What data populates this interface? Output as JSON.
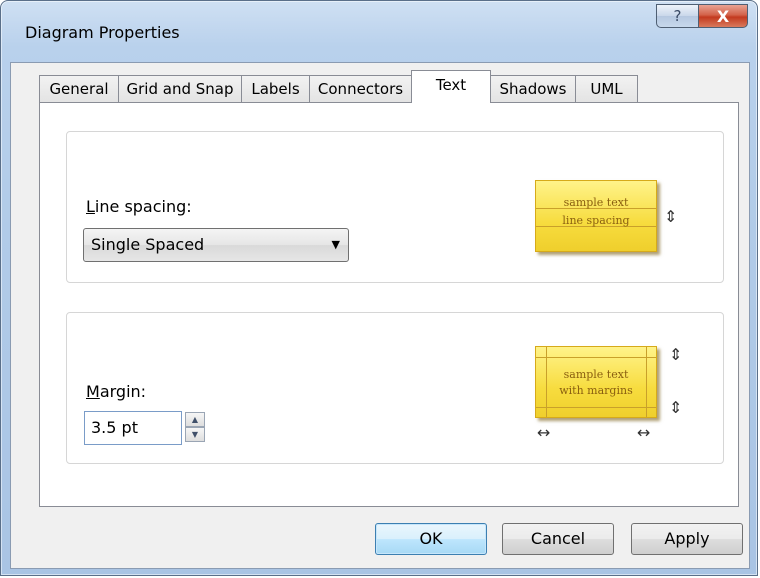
{
  "window": {
    "title": "Diagram Properties",
    "help_label": "?",
    "close_label": "X"
  },
  "tabs": [
    {
      "label": "General",
      "active": false
    },
    {
      "label": "Grid and Snap",
      "active": false
    },
    {
      "label": "Labels",
      "active": false
    },
    {
      "label": "Connectors",
      "active": false
    },
    {
      "label": "Text",
      "active": true
    },
    {
      "label": "Shadows",
      "active": false
    },
    {
      "label": "UML",
      "active": false
    }
  ],
  "line_spacing": {
    "label_mnemonic": "L",
    "label_rest": "ine spacing:",
    "selected": "Single Spaced",
    "dropdown_icon": "triangle-down",
    "preview_line1": "sample text",
    "preview_line2": "line spacing",
    "preview_color": "#f7dc3e",
    "arrow_glyph": "⇕"
  },
  "margin": {
    "label_mnemonic": "M",
    "label_rest": "argin:",
    "value": "3.5 pt",
    "spin_up": "▲",
    "spin_down": "▼",
    "preview_line1": "sample text",
    "preview_line2": "with margins",
    "vertical_arrow_glyph": "⇕",
    "horizontal_arrow_glyph": "↔"
  },
  "buttons": {
    "ok": "OK",
    "cancel": "Cancel",
    "apply": "Apply"
  }
}
